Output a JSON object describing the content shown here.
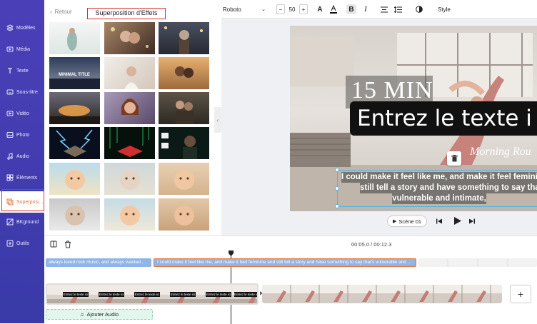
{
  "sidebar": {
    "items": [
      {
        "label": "Modèles",
        "icon": "layers-icon"
      },
      {
        "label": "Média",
        "icon": "folder-icon"
      },
      {
        "label": "Texte",
        "icon": "text-icon"
      },
      {
        "label": "Sous-titre",
        "icon": "subtitle-icon"
      },
      {
        "label": "Vidéo",
        "icon": "video-icon"
      },
      {
        "label": "Photo",
        "icon": "photo-icon"
      },
      {
        "label": "Audio",
        "icon": "music-icon"
      },
      {
        "label": "Éléments",
        "icon": "elements-icon"
      },
      {
        "label": "Superposi...",
        "icon": "overlay-icon"
      },
      {
        "label": "BKground",
        "icon": "background-icon"
      },
      {
        "label": "Outils",
        "icon": "tools-icon"
      }
    ]
  },
  "panel": {
    "back_label": "Retour",
    "title": "Superposition d'Effets",
    "thumb_text": "MINIMAL TITLE"
  },
  "toolbar": {
    "font": "Roboto",
    "font_size": "50",
    "minus": "−",
    "plus": "+",
    "style_label": "Style"
  },
  "canvas": {
    "text_15min": "15 MIN",
    "text_main": "Entrez le texte i",
    "text_morning": "Morning Rou",
    "subtitle_line1": "I could make it feel like me, and make it feel femini",
    "subtitle_line2": "still tell a story and have something to say tha",
    "subtitle_line3": "vulnerable and intimate,",
    "scene_label": "Scène 01"
  },
  "timeline": {
    "time_current": "00:05.0",
    "time_total": "00:12.3",
    "time_sep": " / ",
    "caption1": "always loved rock music, and always wanted ...",
    "caption2": "I could make it feel like me, and make it feel feminine and still tell a story and have something to say that's vulnerable and ...",
    "clip_text": "Entrez le texte ici",
    "add_audio": "Ajouter Audio",
    "add_button": "+"
  },
  "colors": {
    "sidebar": "#4b3fb8",
    "accent_orange": "#e8733a",
    "highlight_red": "#d9302c",
    "caption_blue": "#8fb4e8"
  }
}
